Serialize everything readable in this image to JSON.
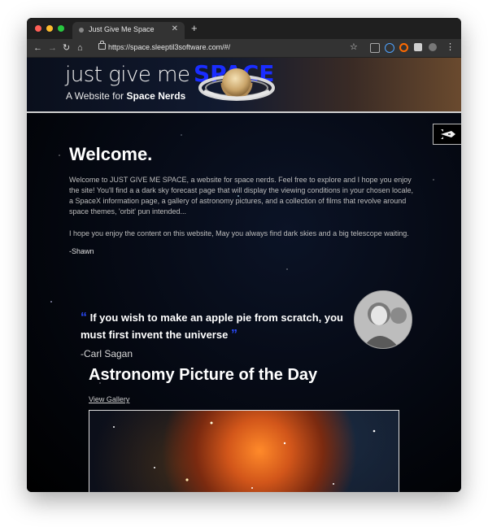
{
  "browser": {
    "tab_title": "Just Give Me Space",
    "url": "https://space.sleeptil3software.com/#/",
    "new_tab": "+",
    "tab_close": "✕",
    "back": "←",
    "forward": "→",
    "reload": "↻",
    "home": "⌂",
    "bookmark": "☆",
    "menu": "⋮"
  },
  "header": {
    "logo_prefix": "just give me",
    "logo_highlight": "SPACE",
    "tagline_prefix": "A Website for",
    "tagline_bold": "Space Nerds"
  },
  "welcome": {
    "title": "Welcome.",
    "paragraph1": "Welcome to JUST GIVE ME SPACE, a website for space nerds. Feel free to explore and I hope you enjoy the site! You'll find a a dark sky forecast page that will display the viewing conditions in your chosen locale, a SpaceX information page, a gallery of astronomy pictures, and a collection of films that revolve around space themes, 'orbit' pun intended...",
    "paragraph2": "I hope you enjoy the content on this website, May you always find dark skies and a big telescope waiting.",
    "signature": "-Shawn"
  },
  "quote": {
    "open_mark": "“",
    "text": "If you wish to make an apple pie from scratch, you must first invent the universe",
    "close_mark": "”",
    "author": "-Carl Sagan"
  },
  "apod": {
    "title": "Astronomy Picture of the Day",
    "gallery_link": "View Gallery"
  },
  "colors": {
    "accent_blue": "#1a2dff",
    "quote_mark_blue": "#2a4bff"
  },
  "icons": [
    "search-icon",
    "lock-icon",
    "star-icon",
    "extension-icon",
    "rocket-icon"
  ]
}
